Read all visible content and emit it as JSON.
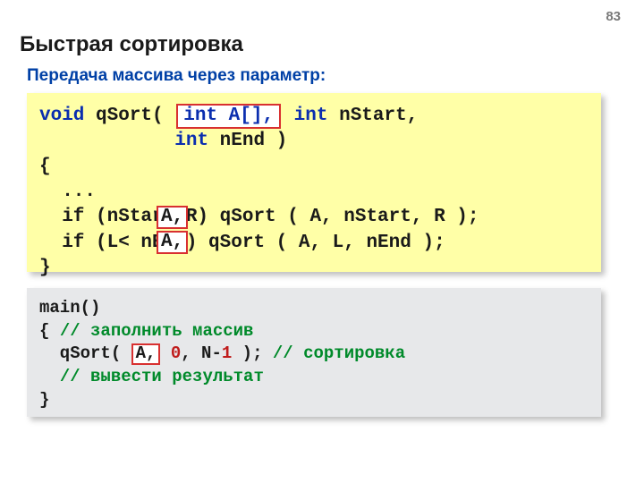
{
  "page_number": "83",
  "title": "Быстрая сортировка",
  "subtitle": "Передача массива через параметр:",
  "code1": {
    "kw_void": "void",
    "fn": " qSort( ",
    "param_hl": "int A[],",
    "kw_int1": " int",
    "p1": " nStart,",
    "indent2": "            ",
    "kw_int2": "int",
    "p2": " nEnd )",
    "brace_open": "{",
    "dots": "  ...",
    "if1": "  if (nStart<R) qSort ( A, nStart, R );",
    "if2": "  if (L< nEnd) qSort ( A, L, nEnd );",
    "brace_close": "}",
    "a1": "A,",
    "a2": "A,"
  },
  "code2": {
    "main": "main()",
    "brace_open": "{ ",
    "cm_fill": "// заполнить массив",
    "call_pre": "  qSort( ",
    "call_a": "A,",
    "zero": " 0",
    "call_mid": ", N-",
    "one": "1",
    "call_end": " ); ",
    "cm_sort": "// сортировка",
    "cm_out_pre": "  ",
    "cm_out": "// вывести результат",
    "brace_close": "}"
  }
}
